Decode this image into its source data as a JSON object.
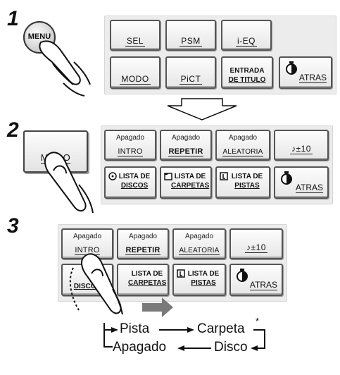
{
  "steps": [
    "1",
    "2",
    "3"
  ],
  "menu_button": "MENU",
  "step1": {
    "row1": [
      "SEL",
      "PSM",
      "i-EQ"
    ],
    "row2": [
      "MODO",
      "PiCT"
    ],
    "entrada": [
      "ENTRADA",
      "DE TITULO"
    ],
    "atras": "ATRAS"
  },
  "modo_button": "MODO",
  "panel": {
    "status": "Apagado",
    "intro": "INTRO",
    "repetir": "REPETIR",
    "aleatoria": "ALEATORIA",
    "skip": "♪±10",
    "lista_discos": [
      "LISTA DE",
      "DISCOS"
    ],
    "lista_carpetas": [
      "LISTA DE",
      "CARPETAS"
    ],
    "lista_pistas": [
      "LISTA DE",
      "PISTAS"
    ],
    "atras": "ATRAS"
  },
  "cycle": {
    "pista": "Pista",
    "carpeta": "Carpeta",
    "asterisk": "*",
    "apagado": "Apagado",
    "disco": "Disco"
  }
}
